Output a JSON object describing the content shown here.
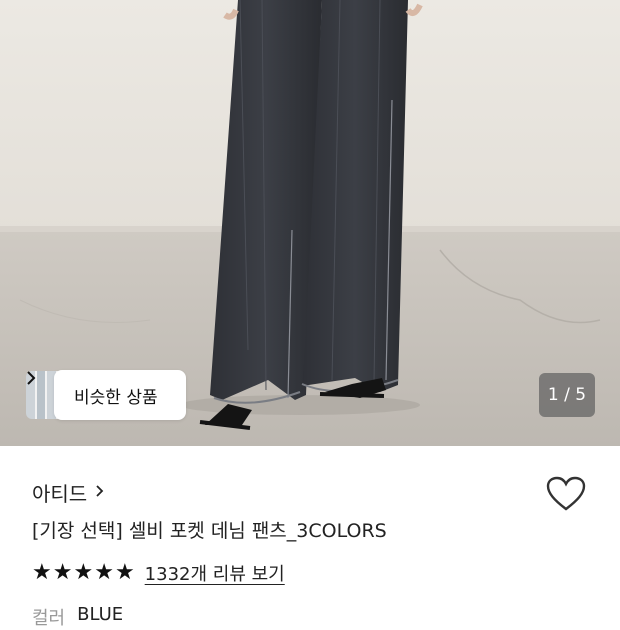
{
  "hero": {
    "similar_label": "비슷한 상품",
    "chevron_icon": "chevron-right-icon",
    "page_current": "1",
    "page_sep": "/",
    "page_total": "5",
    "counter_text": "1 / 5"
  },
  "product": {
    "brand": "아티드",
    "brand_chevron": ">",
    "title": "[기장 선택] 셀비 포켓 데님 팬츠_3COLORS",
    "rating_stars": 5,
    "reviews_link": "1332개 리뷰 보기",
    "color_label": "컬러",
    "color_value": "BLUE"
  },
  "icons": {
    "heart": "heart-outline-icon",
    "star": "star-icon"
  }
}
